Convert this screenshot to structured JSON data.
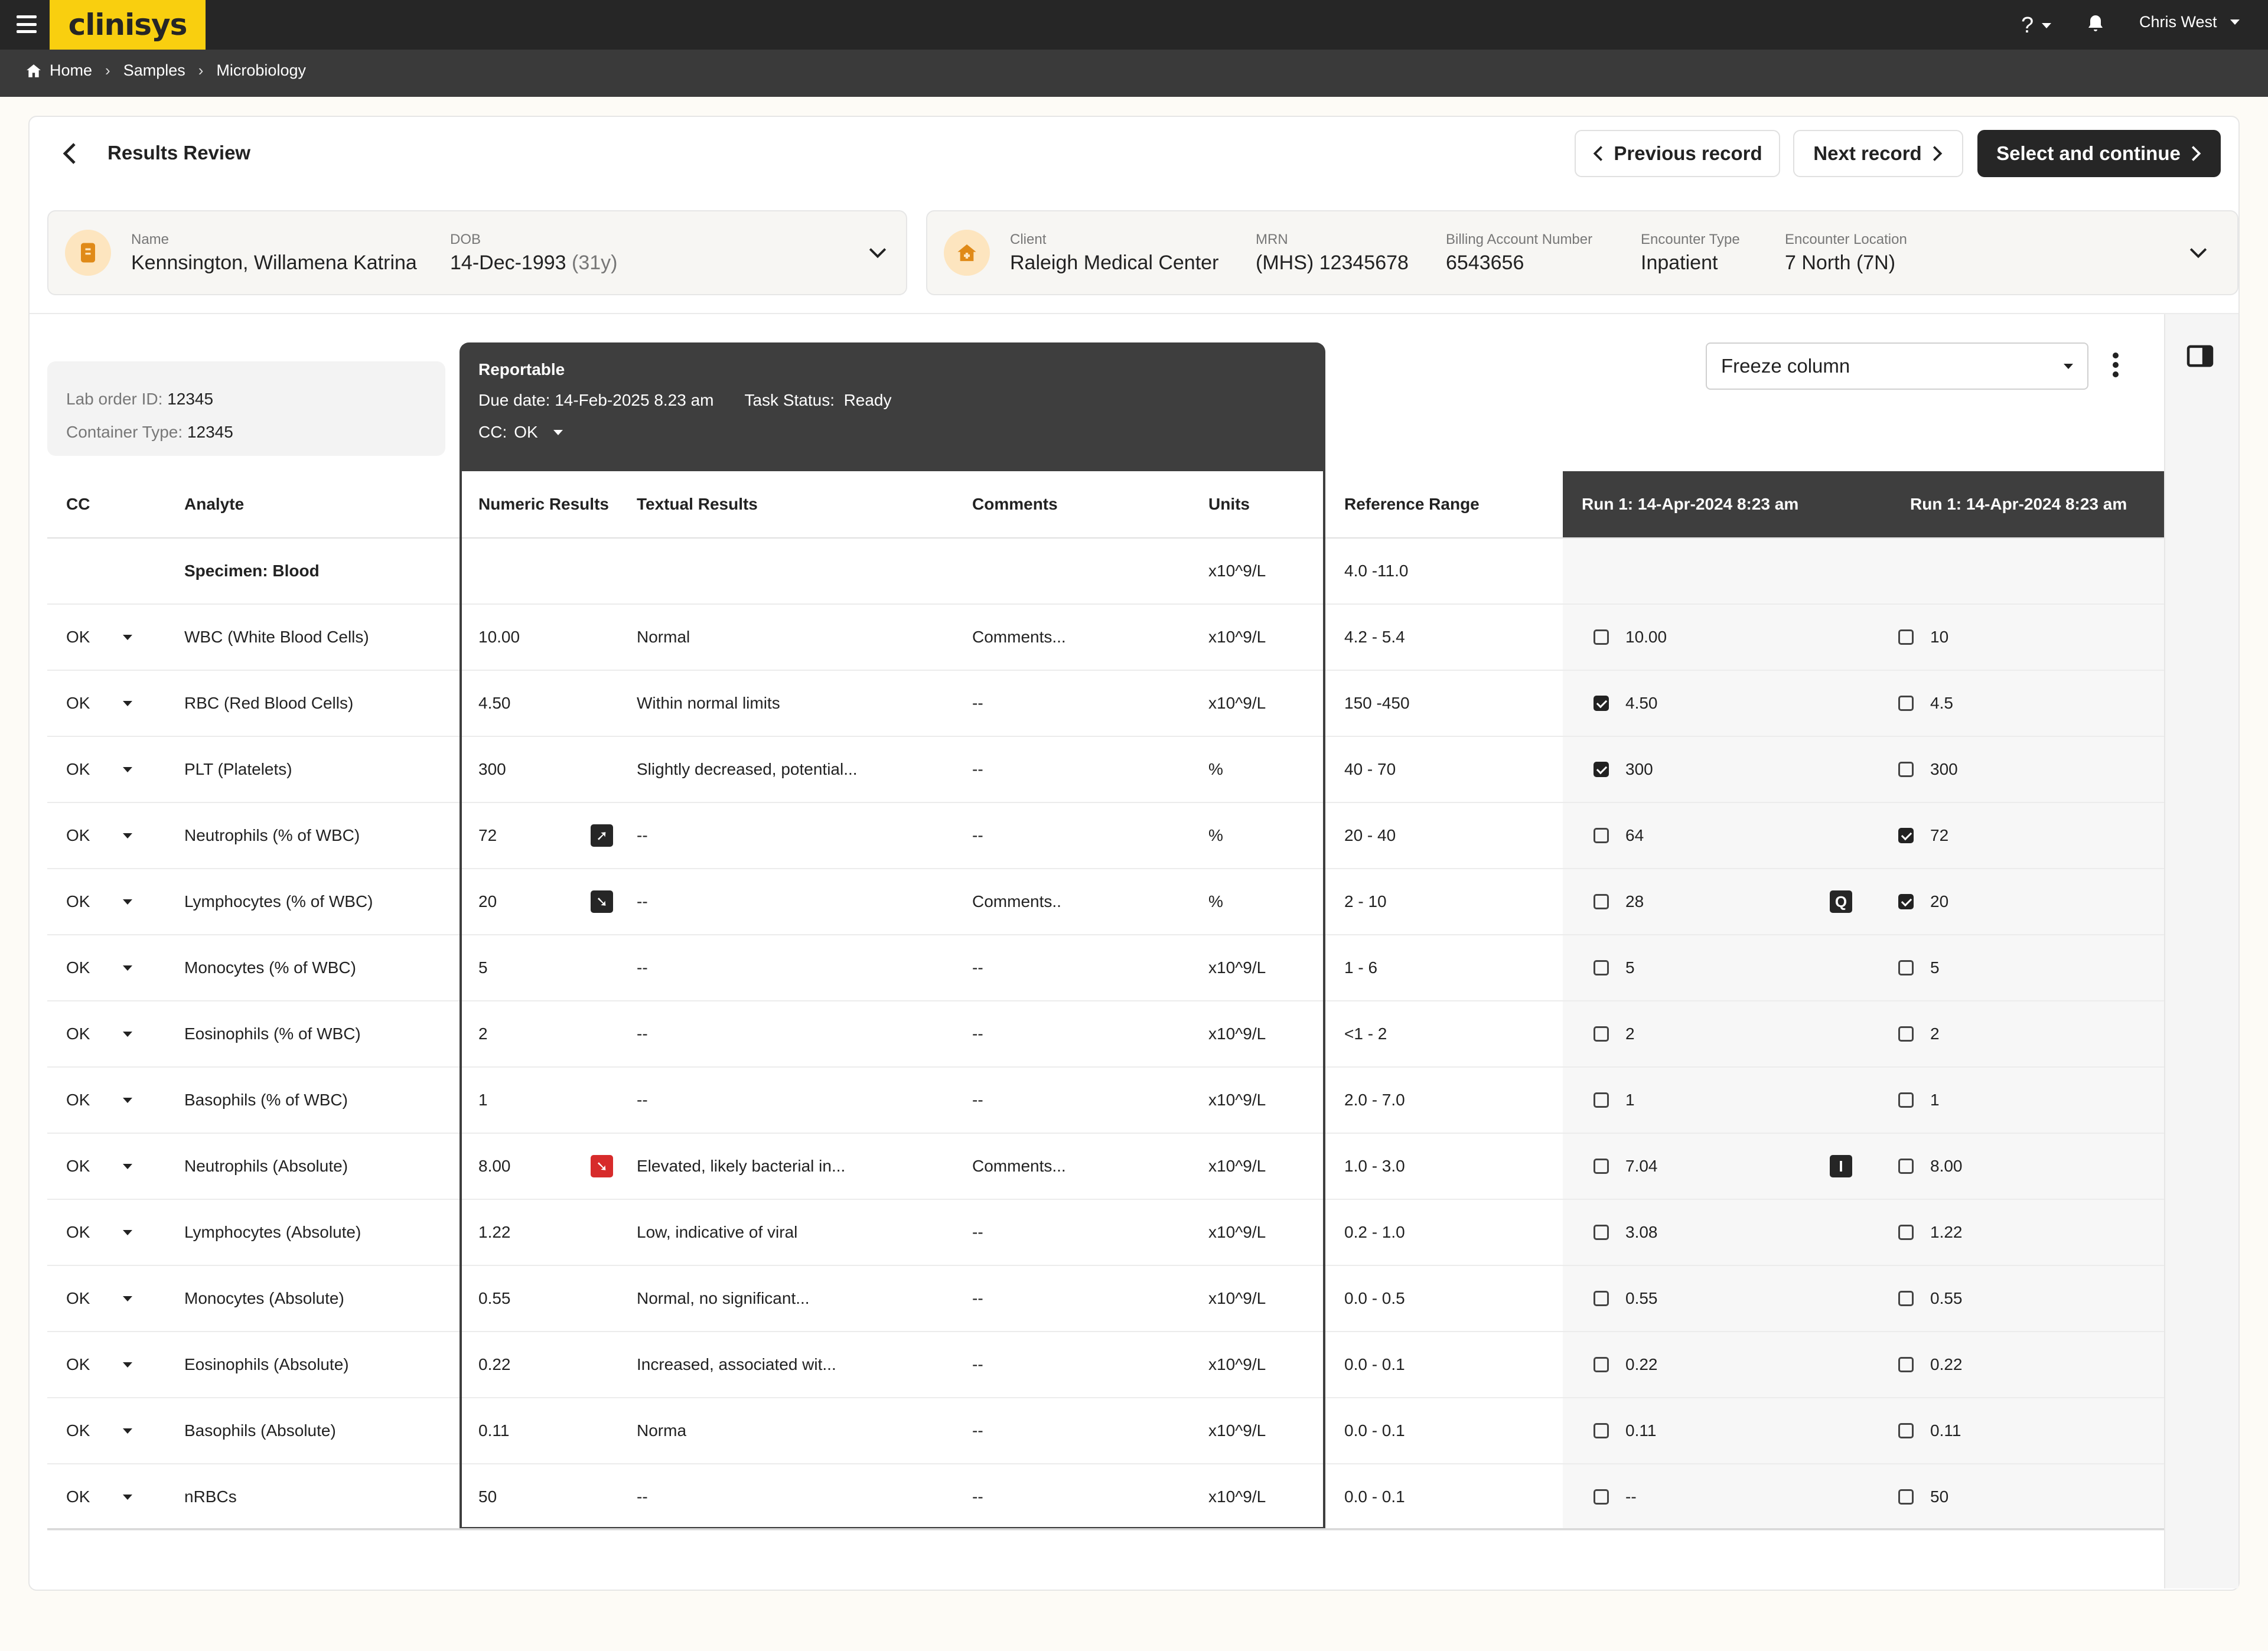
{
  "app": {
    "logo": "clinisys",
    "help_label": "?",
    "user_name": "Chris West"
  },
  "breadcrumb": [
    "Home",
    "Samples",
    "Microbiology"
  ],
  "page": {
    "title": "Results Review",
    "prev_label": "Previous record",
    "next_label": "Next record",
    "continue_label": "Select and continue"
  },
  "patient": {
    "name_label": "Name",
    "name": "Kennsington, Willamena Katrina",
    "dob_label": "DOB",
    "dob": "14-Dec-1993",
    "age": "(31y)"
  },
  "encounter": {
    "client_label": "Client",
    "client": "Raleigh Medical Center",
    "mrn_label": "MRN",
    "mrn": "(MHS) 12345678",
    "billing_label": "Billing Account Number",
    "billing": "6543656",
    "type_label": "Encounter Type",
    "type": "Inpatient",
    "location_label": "Encounter Location",
    "location": "7 North (7N)"
  },
  "lab_order": {
    "id_label": "Lab order ID:",
    "id": "12345",
    "container_label": "Container Type:",
    "container": "12345"
  },
  "reportable": {
    "title": "Reportable",
    "due_label": "Due date:",
    "due": "14-Feb-2025 8.23 am",
    "task_label": "Task Status:",
    "task": "Ready",
    "cc_label": "CC:",
    "cc": "OK"
  },
  "freeze": {
    "label": "Freeze column"
  },
  "columns": {
    "cc": "CC",
    "analyte": "Analyte",
    "numeric": "Numeric Results",
    "textual": "Textual Results",
    "comments": "Comments",
    "units": "Units",
    "range": "Reference Range",
    "run1": "Run 1: 14-Apr-2024 8:23 am",
    "run2": "Run 1: 14-Apr-2024 8:23 am"
  },
  "specimen": {
    "label": "Specimen: Blood",
    "units": "x10^9/L",
    "range": "4.0 -11.0"
  },
  "colors": {
    "accent": "#f9cf0f",
    "dark": "#262626",
    "alert": "#d72b2b"
  },
  "rows": [
    {
      "cc": "OK",
      "analyte": "WBC (White Blood Cells)",
      "numeric": "10.00",
      "flag": "",
      "textual": "Normal",
      "comments": "Comments...",
      "units": "x10^9/L",
      "range": "4.2 - 5.4",
      "r1": "10.00",
      "r1c": false,
      "r1f": "",
      "r2": "10",
      "r2c": false
    },
    {
      "cc": "OK",
      "analyte": "RBC (Red Blood Cells)",
      "numeric": "4.50",
      "flag": "",
      "textual": "Within normal limits",
      "comments": "--",
      "units": "x10^9/L",
      "range": "150 -450",
      "r1": "4.50",
      "r1c": true,
      "r1f": "",
      "r2": "4.5",
      "r2c": false
    },
    {
      "cc": "OK",
      "analyte": "PLT (Platelets)",
      "numeric": "300",
      "flag": "",
      "textual": "Slightly decreased, potential...",
      "comments": "--",
      "units": "%",
      "range": "40 - 70",
      "r1": "300",
      "r1c": true,
      "r1f": "",
      "r2": "300",
      "r2c": false
    },
    {
      "cc": "OK",
      "analyte": "Neutrophils (% of WBC)",
      "numeric": "72",
      "flag": "arrow-up-right-icon",
      "textual": "--",
      "comments": "--",
      "units": "%",
      "range": "20 - 40",
      "r1": "64",
      "r1c": false,
      "r1f": "",
      "r2": "72",
      "r2c": true
    },
    {
      "cc": "OK",
      "analyte": "Lymphocytes (% of WBC)",
      "numeric": "20",
      "flag": "arrow-down-right-icon",
      "textual": "--",
      "comments": "Comments..",
      "units": "%",
      "range": "2 - 10",
      "r1": "28",
      "r1c": false,
      "r1f": "Q",
      "r2": "20",
      "r2c": true
    },
    {
      "cc": "OK",
      "analyte": "Monocytes (% of WBC)",
      "numeric": "5",
      "flag": "",
      "textual": "--",
      "comments": "--",
      "units": "x10^9/L",
      "range": "1 - 6",
      "r1": "5",
      "r1c": false,
      "r1f": "",
      "r2": "5",
      "r2c": false
    },
    {
      "cc": "OK",
      "analyte": "Eosinophils (% of WBC)",
      "numeric": "2",
      "flag": "",
      "textual": "--",
      "comments": "--",
      "units": "x10^9/L",
      "range": "<1 - 2",
      "r1": "2",
      "r1c": false,
      "r1f": "",
      "r2": "2",
      "r2c": false
    },
    {
      "cc": "OK",
      "analyte": "Basophils (% of WBC)",
      "numeric": "1",
      "flag": "",
      "textual": "--",
      "comments": "--",
      "units": "x10^9/L",
      "range": "2.0 - 7.0",
      "r1": "1",
      "r1c": false,
      "r1f": "",
      "r2": "1",
      "r2c": false
    },
    {
      "cc": "OK",
      "analyte": "Neutrophils (Absolute)",
      "numeric": "8.00",
      "flag": "arrow-down-right-red-icon",
      "textual": "Elevated, likely bacterial in...",
      "comments": "Comments...",
      "units": "x10^9/L",
      "range": "1.0 - 3.0",
      "r1": "7.04",
      "r1c": false,
      "r1f": "I",
      "r2": "8.00",
      "r2c": false
    },
    {
      "cc": "OK",
      "analyte": "Lymphocytes (Absolute)",
      "numeric": "1.22",
      "flag": "",
      "textual": "Low, indicative of viral",
      "comments": "--",
      "units": "x10^9/L",
      "range": "0.2 - 1.0",
      "r1": "3.08",
      "r1c": false,
      "r1f": "",
      "r2": "1.22",
      "r2c": false
    },
    {
      "cc": "OK",
      "analyte": "Monocytes (Absolute)",
      "numeric": "0.55",
      "flag": "",
      "textual": "Normal, no significant...",
      "comments": "--",
      "units": "x10^9/L",
      "range": "0.0 - 0.5",
      "r1": "0.55",
      "r1c": false,
      "r1f": "",
      "r2": "0.55",
      "r2c": false
    },
    {
      "cc": "OK",
      "analyte": "Eosinophils (Absolute)",
      "numeric": "0.22",
      "flag": "",
      "textual": "Increased, associated wit...",
      "comments": "--",
      "units": "x10^9/L",
      "range": "0.0 - 0.1",
      "r1": "0.22",
      "r1c": false,
      "r1f": "",
      "r2": "0.22",
      "r2c": false
    },
    {
      "cc": "OK",
      "analyte": "Basophils (Absolute)",
      "numeric": "0.11",
      "flag": "",
      "textual": "Norma",
      "comments": "--",
      "units": "x10^9/L",
      "range": "0.0 - 0.1",
      "r1": "0.11",
      "r1c": false,
      "r1f": "",
      "r2": "0.11",
      "r2c": false
    },
    {
      "cc": "OK",
      "analyte": "nRBCs",
      "numeric": "50",
      "flag": "",
      "textual": "--",
      "comments": "--",
      "units": "x10^9/L",
      "range": "0.0 - 0.1",
      "r1": "--",
      "r1c": false,
      "r1f": "",
      "r2": "50",
      "r2c": false
    }
  ]
}
